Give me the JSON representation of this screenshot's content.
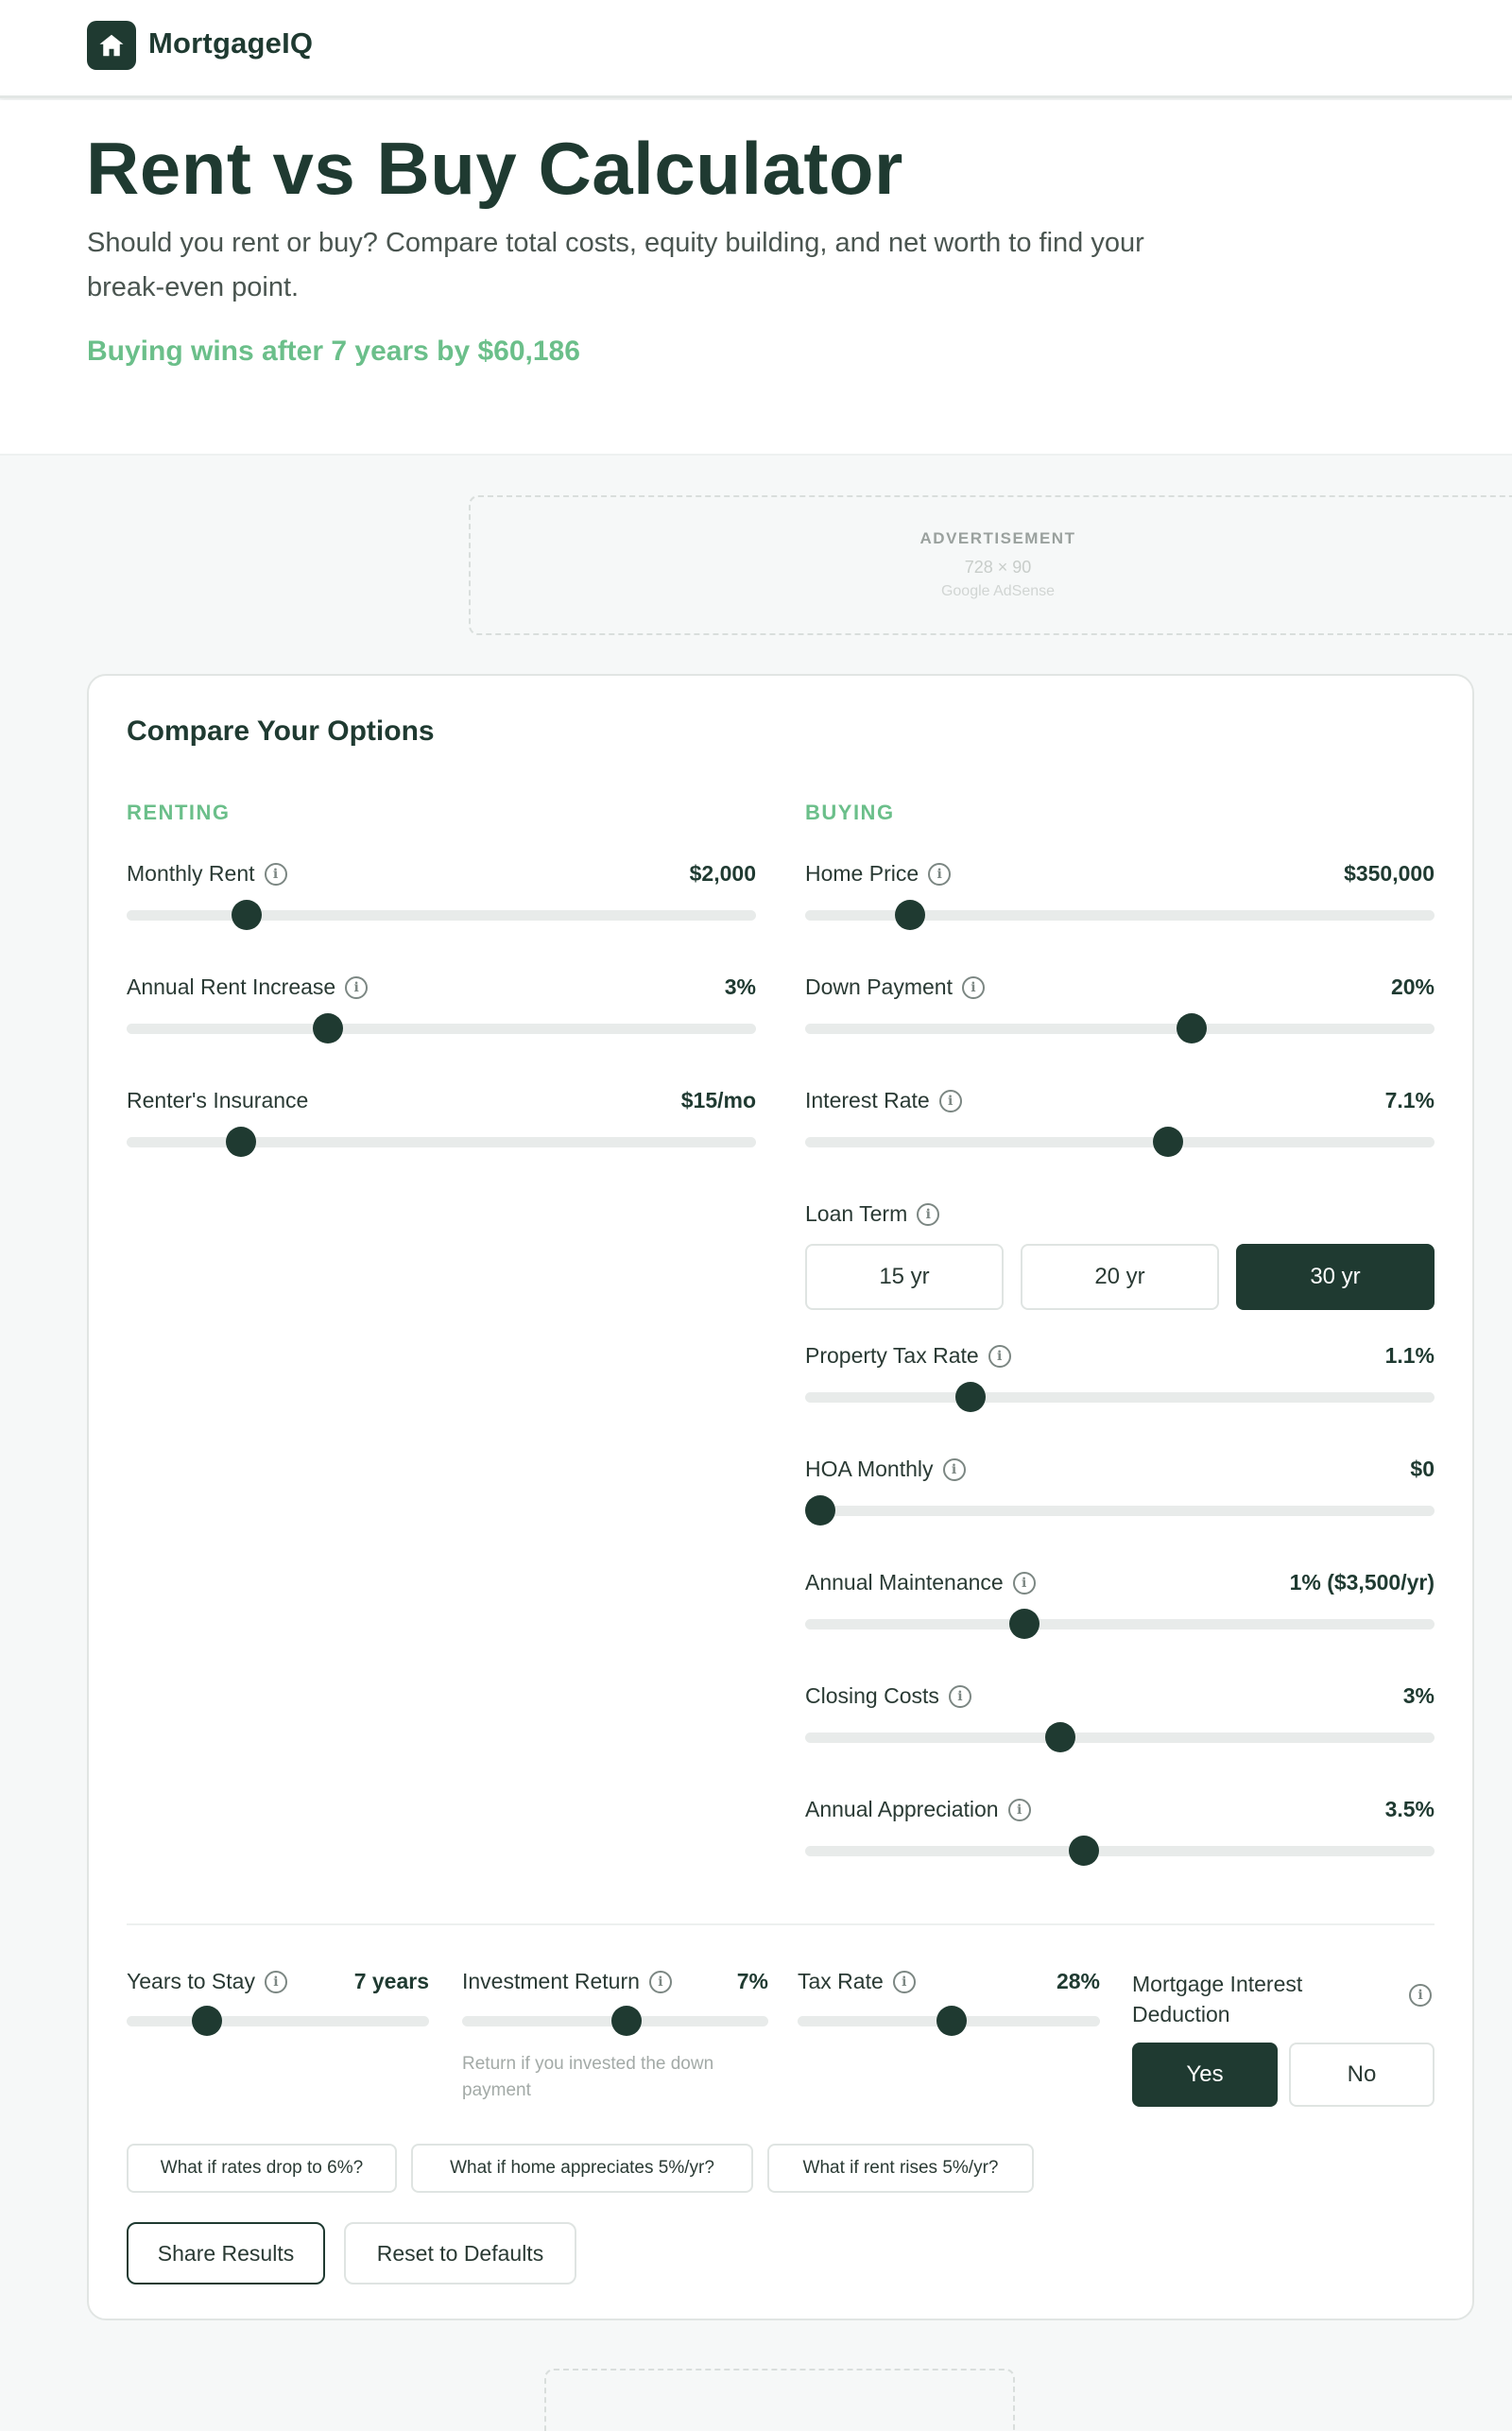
{
  "brand": {
    "name": "MortgageIQ"
  },
  "hero": {
    "title": "Rent vs Buy Calculator",
    "subtitle": "Should you rent or buy? Compare total costs, equity building, and net worth to find your break-even point.",
    "verdict": "Buying wins after 7 years by $60,186"
  },
  "ad": {
    "label": "ADVERTISEMENT",
    "size": "728 × 90",
    "provider": "Google AdSense"
  },
  "card": {
    "title": "Compare Your Options",
    "renting_label": "RENTING",
    "buying_label": "BUYING"
  },
  "renting": [
    {
      "label": "Monthly Rent",
      "value": "$2,000",
      "info": true,
      "level": 0.175
    },
    {
      "label": "Annual Rent Increase",
      "value": "3%",
      "info": true,
      "level": 0.31
    },
    {
      "label": "Renter's Insurance",
      "value": "$15/mo",
      "info": false,
      "level": 0.165
    }
  ],
  "buying": [
    {
      "label": "Home Price",
      "value": "$350,000",
      "info": true,
      "level": 0.15
    },
    {
      "label": "Down Payment",
      "value": "20%",
      "info": true,
      "level": 0.62
    },
    {
      "label": "Interest Rate",
      "value": "7.1%",
      "info": true,
      "level": 0.58
    }
  ],
  "loan_term": {
    "label": "Loan Term",
    "options": [
      "15 yr",
      "20 yr",
      "30 yr"
    ],
    "selected": "30 yr"
  },
  "buying_more": [
    {
      "label": "Property Tax Rate",
      "value": "1.1%",
      "info": true,
      "level": 0.25
    },
    {
      "label": "HOA Monthly",
      "value": "$0",
      "info": true,
      "level": 0.0
    },
    {
      "label": "Annual Maintenance",
      "value": "1% ($3,500/yr)",
      "info": true,
      "level": 0.34
    },
    {
      "label": "Closing Costs",
      "value": "3%",
      "info": true,
      "level": 0.4
    },
    {
      "label": "Annual Appreciation",
      "value": "3.5%",
      "info": true,
      "level": 0.44
    }
  ],
  "bottom": {
    "years": {
      "label": "Years to Stay",
      "value": "7 years",
      "level": 0.24
    },
    "investment": {
      "label": "Investment Return",
      "value": "7%",
      "level": 0.54,
      "note": "Return if you invested the down payment"
    },
    "tax": {
      "label": "Tax Rate",
      "value": "28%",
      "level": 0.51
    },
    "deduction": {
      "label": "Mortgage Interest Deduction",
      "yes": "Yes",
      "no": "No",
      "selected": "Yes"
    }
  },
  "chips": [
    "What if rates drop to 6%?",
    "What if home appreciates 5%/yr?",
    "What if rent rises 5%/yr?"
  ],
  "actions": {
    "share": "Share Results",
    "reset": "Reset to Defaults"
  },
  "colors": {
    "brand": "#1f3a31",
    "accent_green": "#6bbf8a",
    "track": "#e8ebea"
  }
}
